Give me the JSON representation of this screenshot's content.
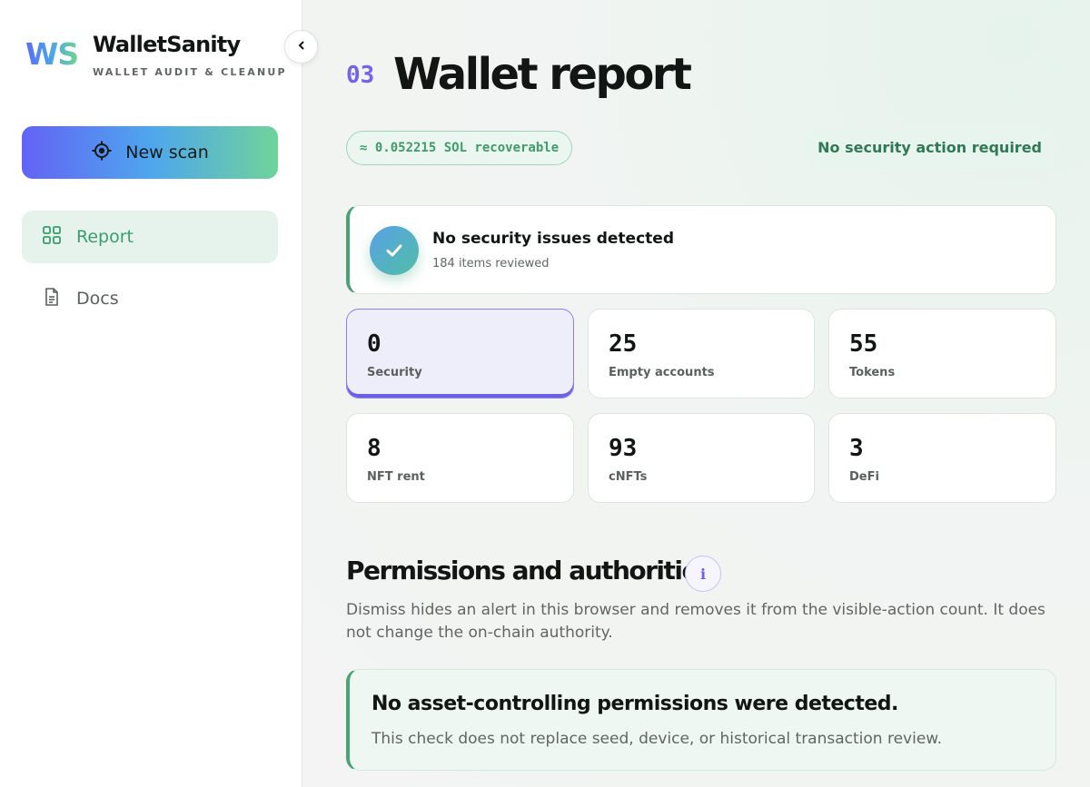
{
  "sidebar": {
    "logo_mark": "WS",
    "brand_name": "WalletSanity",
    "brand_tagline": "WALLET AUDIT & CLEANUP",
    "new_scan_label": "New scan",
    "nav": [
      {
        "label": "Report",
        "icon": "grid-icon",
        "active": true
      },
      {
        "label": "Docs",
        "icon": "document-icon",
        "active": false
      }
    ]
  },
  "header": {
    "step": "03",
    "title": "Wallet report",
    "recoverable": "≈ 0.052215 SOL recoverable",
    "security_status": "No security action required"
  },
  "summary": {
    "title": "No security issues detected",
    "subtitle": "184 items reviewed"
  },
  "stats": [
    {
      "value": "0",
      "label": "Security",
      "active": true
    },
    {
      "value": "25",
      "label": "Empty accounts"
    },
    {
      "value": "55",
      "label": "Tokens"
    },
    {
      "value": "8",
      "label": "NFT rent"
    },
    {
      "value": "93",
      "label": "cNFTs"
    },
    {
      "value": "3",
      "label": "DeFi"
    }
  ],
  "permissions": {
    "title": "Permissions and authorities",
    "info_label": "i",
    "description": "Dismiss hides an alert in this browser and removes it from the visible-action count. It does not change the on-chain authority.",
    "card_title": "No asset-controlling permissions were detected.",
    "card_subtitle": "This check does not replace seed, device, or historical transaction review."
  },
  "colors": {
    "accent_green": "#3c9d6c",
    "accent_purple": "#6b5fe3"
  }
}
